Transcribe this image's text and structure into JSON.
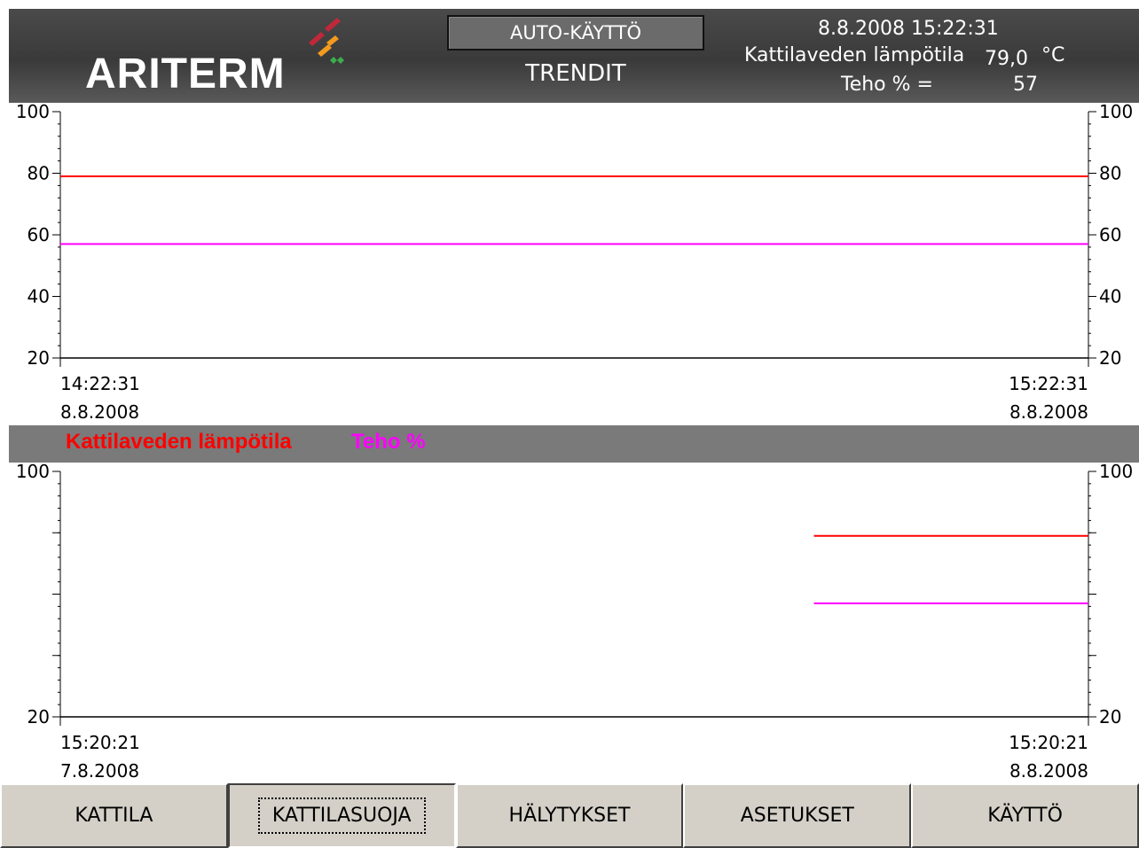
{
  "header": {
    "brand": "ARITERM",
    "mode": "AUTO-KÄYTTÖ",
    "page_title": "TRENDIT",
    "datetime": "8.8.2008 15:22:31",
    "temp_label": "Kattilaveden lämpötila",
    "temp_value": "79,0",
    "temp_unit": "°C",
    "power_label": "Teho % =",
    "power_value": "57"
  },
  "legend": {
    "series1": "Kattilaveden lämpötila",
    "series2": "Teho %"
  },
  "colors": {
    "series1": "#ff0000",
    "series2": "#ff00ff",
    "header_bg": "#3a3a3a"
  },
  "chart_data": [
    {
      "type": "line",
      "ylim": [
        20,
        100
      ],
      "y_ticks_left": [
        "100",
        "80",
        "60",
        "40",
        "20"
      ],
      "y_ticks_right": [
        "100",
        "80",
        "60",
        "40",
        "20"
      ],
      "x_start_time": "14:22:31",
      "x_start_date": "8.8.2008",
      "x_end_time": "15:22:31",
      "x_end_date": "8.8.2008",
      "series": [
        {
          "name": "Kattilaveden lämpötila",
          "color": "#ff0000",
          "points": [
            {
              "t": 0,
              "y": 79
            },
            {
              "t": 1,
              "y": 79
            }
          ]
        },
        {
          "name": "Teho %",
          "color": "#ff00ff",
          "points": [
            {
              "t": 0,
              "y": 57
            },
            {
              "t": 1,
              "y": 57
            }
          ]
        }
      ]
    },
    {
      "type": "line",
      "ylim": [
        20,
        100
      ],
      "y_ticks_left": [
        "100",
        "",
        "",
        "",
        "20"
      ],
      "y_ticks_right": [
        "100",
        "",
        "",
        "",
        "20"
      ],
      "x_start_time": "15:20:21",
      "x_start_date": "7.8.2008",
      "x_end_time": "15:20:21",
      "x_end_date": "8.8.2008",
      "series": [
        {
          "name": "Kattilaveden lämpötila",
          "color": "#ff0000",
          "points": [
            {
              "t": 0.733,
              "y": 79
            },
            {
              "t": 1,
              "y": 79
            }
          ]
        },
        {
          "name": "Teho %",
          "color": "#ff00ff",
          "points": [
            {
              "t": 0.733,
              "y": 57
            },
            {
              "t": 1,
              "y": 57
            }
          ]
        }
      ]
    }
  ],
  "nav": {
    "items": [
      "KATTILA",
      "KATTILASUOJA",
      "HÄLYTYKSET",
      "ASETUKSET",
      "KÄYTTÖ"
    ]
  }
}
